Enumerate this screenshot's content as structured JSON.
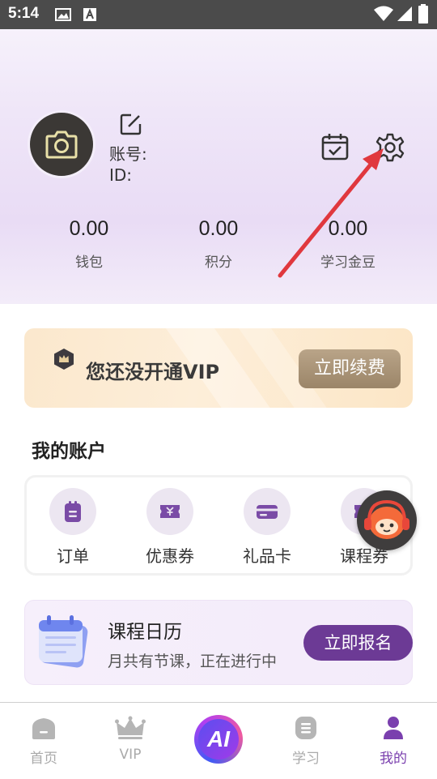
{
  "status_bar": {
    "time": "5:14"
  },
  "profile": {
    "account_label": "账号:",
    "id_label": "ID:"
  },
  "stats": [
    {
      "value": "0.00",
      "label": "钱包"
    },
    {
      "value": "0.00",
      "label": "积分"
    },
    {
      "value": "0.00",
      "label": "学习金豆"
    }
  ],
  "vip": {
    "text": "您还没开通VIP",
    "button": "立即续费"
  },
  "account_section": {
    "title": "我的账户",
    "items": [
      {
        "label": "订单",
        "icon": "order-icon"
      },
      {
        "label": "优惠券",
        "icon": "coupon-icon"
      },
      {
        "label": "礼品卡",
        "icon": "gift-card-icon"
      },
      {
        "label": "课程券",
        "icon": "course-voucher-icon"
      }
    ]
  },
  "course_calendar": {
    "title": "课程日历",
    "subtitle": "月共有节课，正在进行中",
    "button": "立即报名"
  },
  "bottom_nav": {
    "items": [
      {
        "label": "首页",
        "icon": "home-icon"
      },
      {
        "label": "VIP",
        "icon": "crown-icon"
      },
      {
        "label": "AI",
        "icon": "ai-icon"
      },
      {
        "label": "学习",
        "icon": "study-icon"
      },
      {
        "label": "我的",
        "icon": "profile-icon"
      }
    ],
    "active": "我的"
  },
  "colors": {
    "accent": "#6c3a95",
    "vip_button": "#a8936f",
    "annotation_arrow": "#e0383e"
  }
}
